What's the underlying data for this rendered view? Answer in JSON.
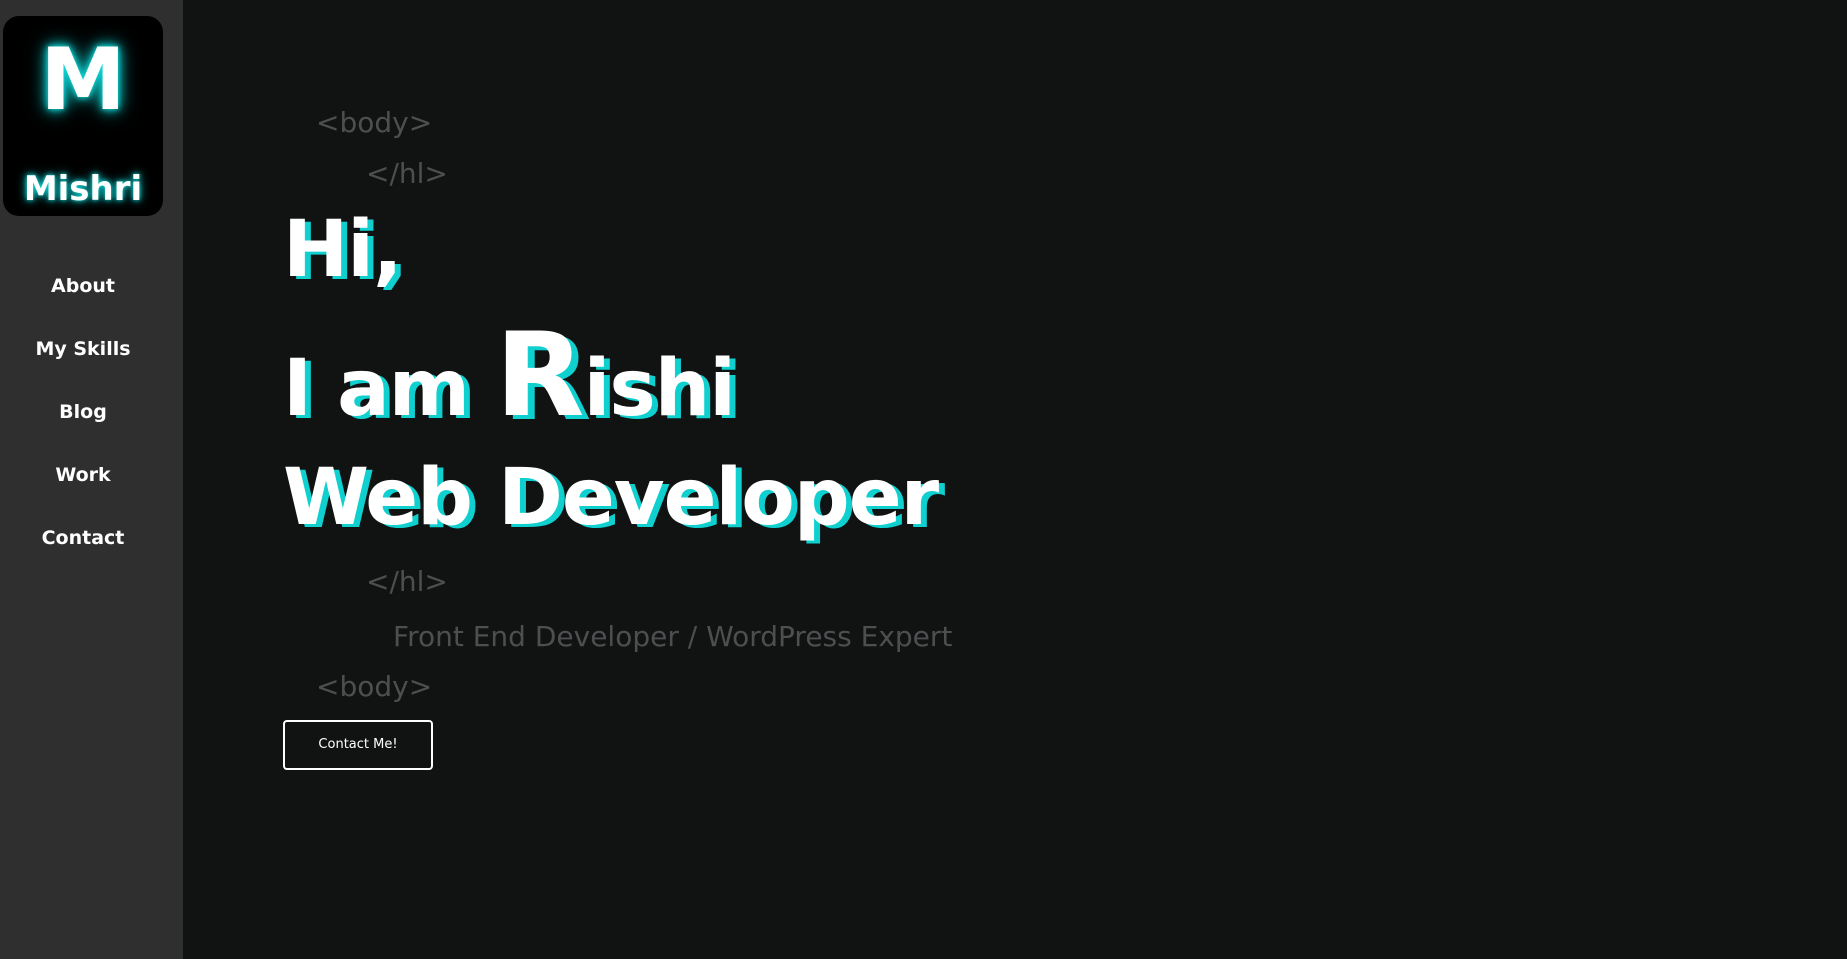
{
  "sidebar": {
    "logo": {
      "letter": "M",
      "name": "Mishri"
    },
    "nav": [
      {
        "label": "About"
      },
      {
        "label": "My Skills"
      },
      {
        "label": "Blog"
      },
      {
        "label": "Work"
      },
      {
        "label": "Contact"
      }
    ]
  },
  "hero": {
    "tag_body_open": "<body>",
    "tag_h1_open": "</hl>",
    "line1": "Hi,",
    "line2_prefix": "I am ",
    "line2_initial": "R",
    "line2_rest": "ishi",
    "line3": "Web Developer",
    "tag_h1_close": "</hl>",
    "subtitle": "Front End Developer / WordPress Expert",
    "tag_body_close": "<body>",
    "cta_label": "Contact Me!"
  },
  "colors": {
    "background": "#111313",
    "sidebar": "#2f2f30",
    "accent": "#0fcfcf",
    "text": "#ffffff",
    "muted": "#4d4e4f"
  }
}
